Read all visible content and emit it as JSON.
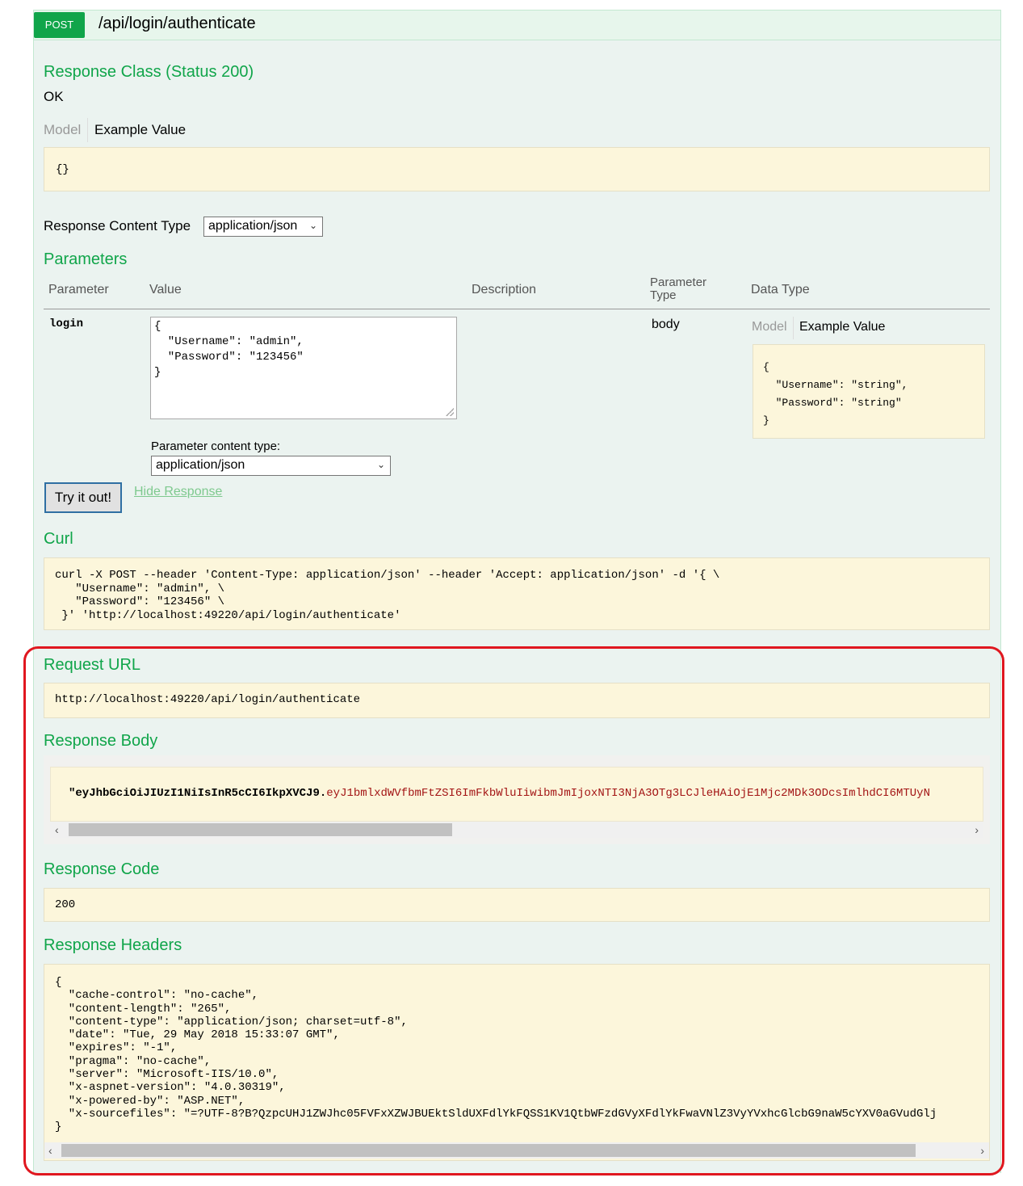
{
  "operation": {
    "method": "POST",
    "path": "/api/login/authenticate"
  },
  "response_class": {
    "title": "Response Class (Status 200)",
    "status_text": "OK",
    "tab_model": "Model",
    "tab_example": "Example Value",
    "example": "{}"
  },
  "response_content_type": {
    "label": "Response Content Type",
    "value": "application/json"
  },
  "parameters": {
    "title": "Parameters",
    "headers": {
      "parameter": "Parameter",
      "value": "Value",
      "description": "Description",
      "parameter_type": "Parameter\nType",
      "data_type": "Data Type"
    },
    "row": {
      "name": "login",
      "value": "{\n  \"Username\": \"admin\",\n  \"Password\": \"123456\"\n}",
      "param_type": "body",
      "content_type_label": "Parameter content type:",
      "content_type_value": "application/json",
      "model_tab": "Model",
      "example_tab": "Example Value",
      "example": "{\n  \"Username\": \"string\",\n  \"Password\": \"string\"\n}"
    }
  },
  "actions": {
    "try_label": "Try it out!",
    "hide_response": "Hide Response"
  },
  "curl": {
    "title": "Curl",
    "command": "curl -X POST --header 'Content-Type: application/json' --header 'Accept: application/json' -d '{ \\\n   \"Username\": \"admin\", \\\n   \"Password\": \"123456\" \\\n }' 'http://localhost:49220/api/login/authenticate'"
  },
  "request_url": {
    "title": "Request URL",
    "value": "http://localhost:49220/api/login/authenticate"
  },
  "response_body": {
    "title": "Response Body",
    "jwt_header": "\"eyJhbGciOiJIUzI1NiIsInR5cCI6IkpXVCJ9.",
    "jwt_payload": "eyJ1bmlxdWVfbmFtZSI6ImFkbWluIiwibmJmIjoxNTI3NjA3OTg3LCJleHAiOjE1Mjc2MDk3ODcsImlhdCI6MTUyN"
  },
  "response_code": {
    "title": "Response Code",
    "value": "200"
  },
  "response_headers": {
    "title": "Response Headers",
    "value": "{\n  \"cache-control\": \"no-cache\",\n  \"content-length\": \"265\",\n  \"content-type\": \"application/json; charset=utf-8\",\n  \"date\": \"Tue, 29 May 2018 15:33:07 GMT\",\n  \"expires\": \"-1\",\n  \"pragma\": \"no-cache\",\n  \"server\": \"Microsoft-IIS/10.0\",\n  \"x-aspnet-version\": \"4.0.30319\",\n  \"x-powered-by\": \"ASP.NET\",\n  \"x-sourcefiles\": \"=?UTF-8?B?QzpcUHJ1ZWJhc05FVFxXZWJBUEktSldUXFdlYkFQSS1KV1QtbWFzdGVyXFdlYkFwaVNlZ3VyYVxhcGlcbG9naW5cYXV0aGVudGlj\n}"
  },
  "colors": {
    "accent_green": "#10a54a",
    "snippet_bg": "#fcf6db",
    "highlight_red": "#e0171f"
  }
}
